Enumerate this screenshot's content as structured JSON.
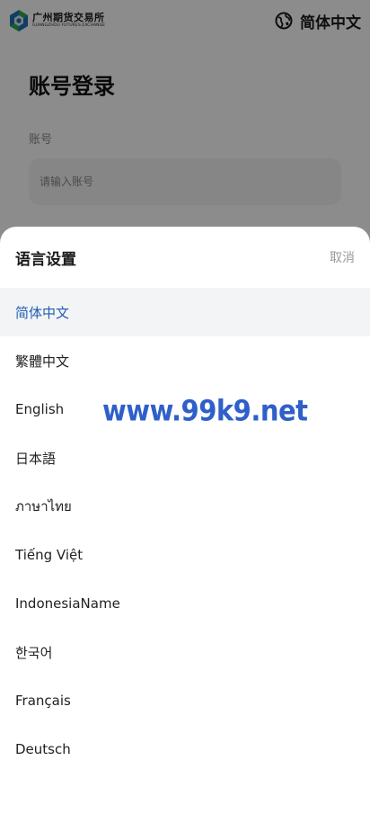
{
  "header": {
    "logo": {
      "name_cn": "广州期货交易所",
      "name_en": "GUANGZHOU FUTURES EXCHANGE",
      "colors": [
        "#1f6fb8",
        "#2fa84f"
      ]
    },
    "language_switch": {
      "icon": "globe-icon",
      "label": "简体中文"
    }
  },
  "login": {
    "title": "账号登录",
    "account_label": "账号",
    "account_placeholder": "请输入账号",
    "account_value": ""
  },
  "language_sheet": {
    "title": "语言设置",
    "cancel_label": "取消",
    "selected_index": 0,
    "options": [
      "简体中文",
      "繁體中文",
      "English",
      "日本語",
      "ภาษาไทย",
      "Tiếng Việt",
      "IndonesiaName",
      "한국어",
      "Français",
      "Deutsch"
    ]
  },
  "watermark": {
    "text": "www.99k9.net",
    "color": "#2f5fc9"
  },
  "colors": {
    "accent": "#1e5db3",
    "selected_bg": "#f3f4f6",
    "overlay": "rgba(0,0,0,0.45)"
  }
}
